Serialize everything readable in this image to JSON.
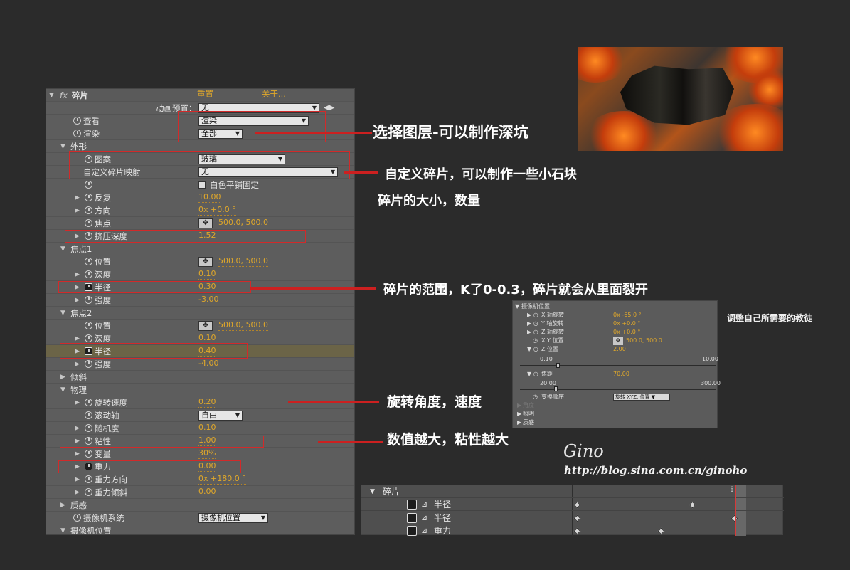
{
  "panel": {
    "title": "碎片",
    "reset": "重置",
    "about": "关于...",
    "preset_label": "动画预置：",
    "preset_value": "无",
    "view_label": "查看",
    "view_value": "渲染",
    "render_label": "渲染",
    "render_value": "全部",
    "shape_group": "外形",
    "pattern_label": "图案",
    "pattern_value": "玻璃",
    "custom_map_label": "自定义碎片映射",
    "custom_map_value": "无",
    "white_tile_label": "白色平铺固定",
    "repeat_label": "反复",
    "repeat_value": "10.00",
    "direction_label": "方向",
    "direction_value": "0x +0.0 °",
    "origin_label": "焦点",
    "origin_value": "500.0, 500.0",
    "extrusion_label": "挤压深度",
    "extrusion_value": "1.52",
    "force1_group": "焦点1",
    "f1_pos_label": "位置",
    "f1_pos_value": "500.0, 500.0",
    "f1_depth_label": "深度",
    "f1_depth_value": "0.10",
    "f1_radius_label": "半径",
    "f1_radius_value": "0.30",
    "f1_strength_label": "强度",
    "f1_strength_value": "-3.00",
    "force2_group": "焦点2",
    "f2_pos_label": "位置",
    "f2_pos_value": "500.0, 500.0",
    "f2_depth_label": "深度",
    "f2_depth_value": "0.10",
    "f2_radius_label": "半径",
    "f2_radius_value": "0.40",
    "f2_strength_label": "强度",
    "f2_strength_value": "-4.00",
    "gradient_group": "倾斜",
    "physics_group": "物理",
    "rot_speed_label": "旋转速度",
    "rot_speed_value": "0.20",
    "tumble_label": "滚动轴",
    "tumble_value": "自由",
    "random_label": "随机度",
    "random_value": "0.10",
    "viscosity_label": "粘性",
    "viscosity_value": "1.00",
    "variation_label": "变量",
    "variation_value": "30%",
    "gravity_label": "重力",
    "gravity_value": "0.00",
    "gravity_dir_label": "重力方向",
    "gravity_dir_value": "0x +180.0 °",
    "gravity_incl_label": "重力倾斜",
    "gravity_incl_value": "0.00",
    "texture_group": "质感",
    "camera_sys_label": "摄像机系统",
    "camera_sys_value": "摄像机位置",
    "camera_pos_group": "摄像机位置"
  },
  "annotations": {
    "a1": "选择图层-可以制作深坑",
    "a2": "自定义碎片，可以制作一些小石块",
    "a3": "碎片的大小，数量",
    "a4": "碎片的范围，K了0-0.3，碎片就会从里面裂开",
    "a5": "旋转角度，速度",
    "a6": "数值越大，粘性越大",
    "note": "调整自己所需要的教徒"
  },
  "camera_panel": {
    "title": "摄像机位置",
    "x_rot_label": "X 轴旋转",
    "x_rot_value": "0x -65.0 °",
    "y_rot_label": "Y 轴旋转",
    "y_rot_value": "0x +0.0 °",
    "z_rot_label": "Z 轴旋转",
    "z_rot_value": "0x +0.0 °",
    "xy_pos_label": "X,Y 位置",
    "xy_pos_value": "500.0, 500.0",
    "z_pos_label": "Z 位置",
    "z_pos_value": "2.00",
    "z_min": "0.10",
    "z_max": "10.00",
    "z_level": 0.19,
    "focal_label": "焦距",
    "focal_value": "70.00",
    "focal_min": "20.00",
    "focal_max": "300.00",
    "focal_level": 0.18,
    "order_label": "变换顺序",
    "order_value": "旋转 XYZ, 位置",
    "lighting_dim": "角度",
    "lighting": "照明",
    "material": "质感"
  },
  "timeline": {
    "group": "碎片",
    "row1": "半径",
    "row2": "半径",
    "row3": "重力"
  },
  "signature": {
    "name": "Gino",
    "url": "http://blog.sina.com.cn/ginoho"
  },
  "colors": {
    "accent_value": "#e0a82a",
    "annotation_red": "#cc2020",
    "panel_bg": "#5d5d5d",
    "page_bg": "#2b2b2b"
  }
}
